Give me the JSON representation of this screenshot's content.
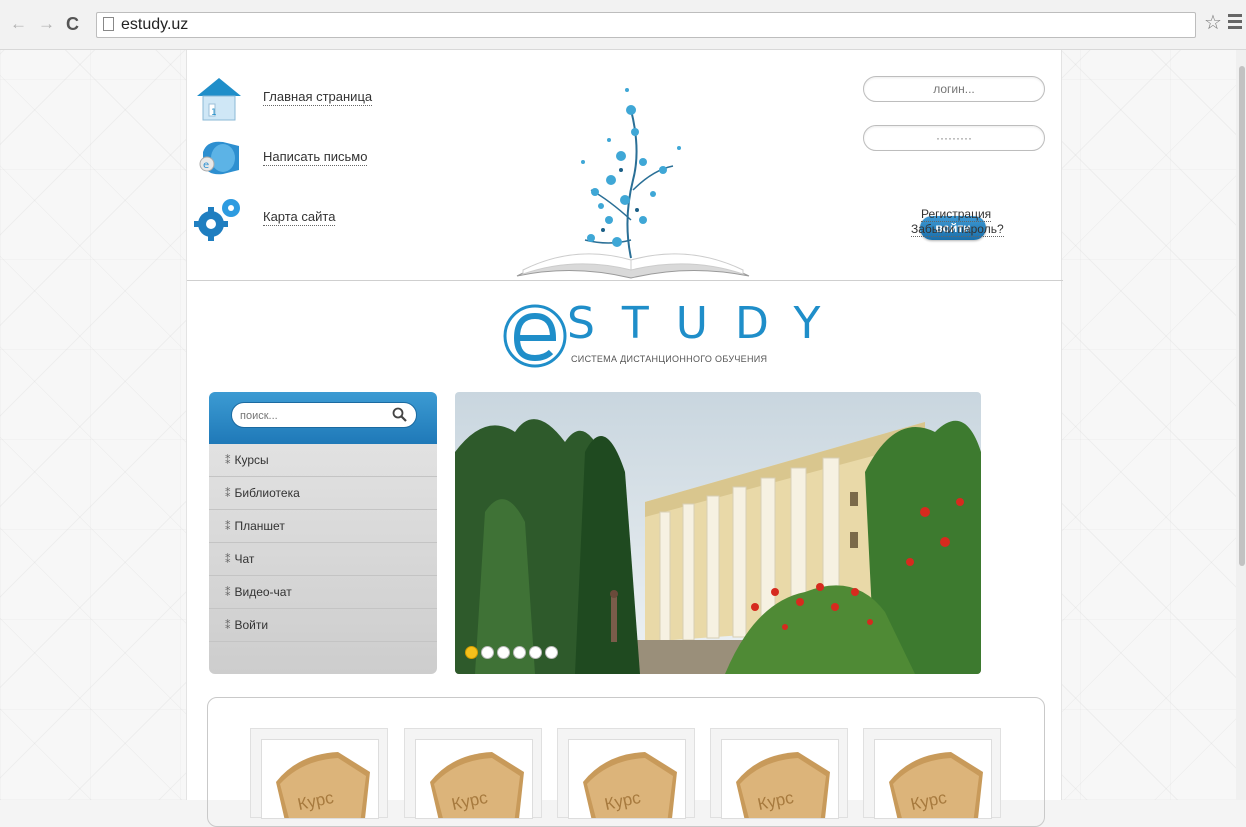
{
  "browser": {
    "back_glyph": "←",
    "forward_glyph": "→",
    "reload_glyph": "C",
    "url": "estudy.uz",
    "star_glyph": "☆"
  },
  "header": {
    "links": [
      {
        "label": "Главная страница",
        "icon": "home-icon"
      },
      {
        "label": "Написать письмо",
        "icon": "mail-icon"
      },
      {
        "label": "Карта сайта",
        "icon": "gears-icon"
      }
    ]
  },
  "login": {
    "login_placeholder": "логин...",
    "password_placeholder": "·········",
    "button_label": "войти",
    "register_label": "Регистрация",
    "forgot_label": "Забыли пароль?"
  },
  "logo": {
    "letters": "STUDY",
    "tagline": "СИСТЕМА ДИСТАНЦИОННОГО ОБУЧЕНИЯ"
  },
  "sidebar": {
    "search_placeholder": "поиск...",
    "items": [
      {
        "label": "Курсы"
      },
      {
        "label": "Библиотека"
      },
      {
        "label": "Планшет"
      },
      {
        "label": "Чат"
      },
      {
        "label": "Видео-чат"
      },
      {
        "label": "Войти"
      }
    ]
  },
  "slider": {
    "active_slide": 1,
    "slide_count": 6
  },
  "courses": {
    "items": [
      {
        "label": "Курс"
      },
      {
        "label": "Курс"
      },
      {
        "label": "Курс"
      },
      {
        "label": "Курс"
      },
      {
        "label": "Курс"
      }
    ]
  },
  "colors": {
    "accent_blue": "#1f8ec9",
    "active_dot": "#f5c11b"
  }
}
